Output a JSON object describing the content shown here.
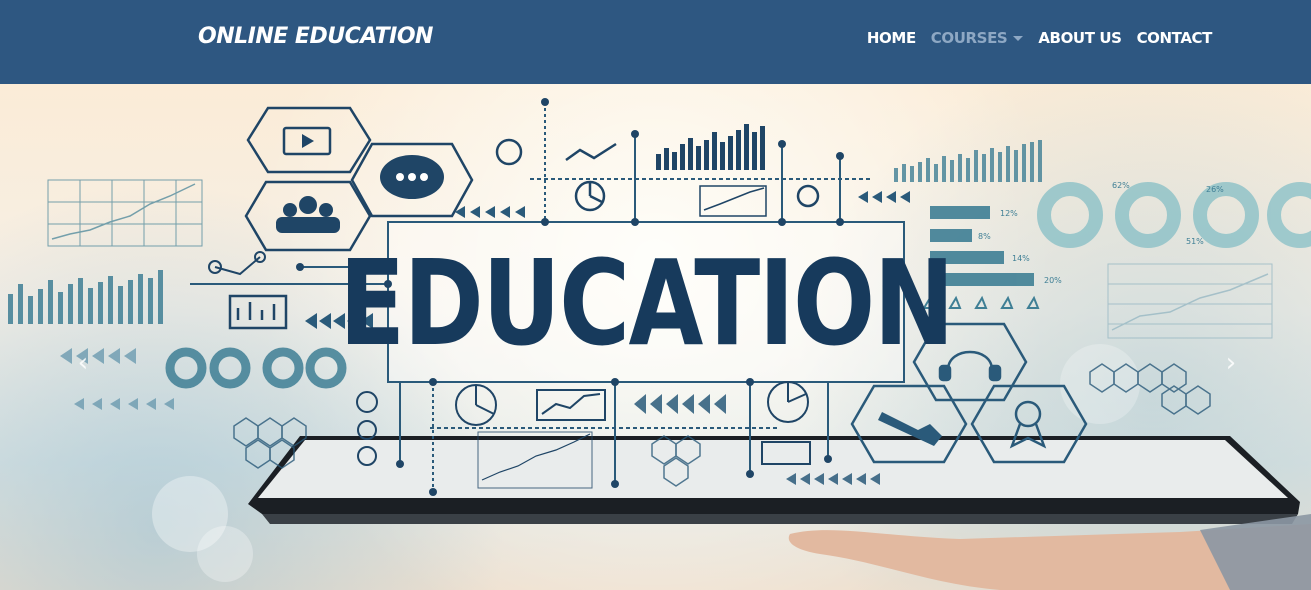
{
  "brand": {
    "title": "ONLINE EDUCATION"
  },
  "nav": {
    "items": [
      {
        "label": "HOME",
        "active": false
      },
      {
        "label": "COURSES",
        "active": true,
        "has_dropdown": true
      },
      {
        "label": "ABOUT US",
        "active": false
      },
      {
        "label": "CONTACT",
        "active": false
      }
    ]
  },
  "hero": {
    "headline": "EDUCATION",
    "prev_icon": "chevron-left-icon",
    "next_icon": "chevron-right-icon",
    "prev_glyph": "‹",
    "next_glyph": "›",
    "stat_labels": [
      "12%",
      "8%",
      "14%",
      "20%"
    ],
    "ring_labels": [
      "62%",
      "26%",
      "51%"
    ]
  },
  "colors": {
    "navbar": "#2e5781",
    "nav_text": "#ffffff",
    "nav_active": "#8ea8c4",
    "headline": "#173a5c",
    "icon_teal": "#3f7f95",
    "icon_navy": "#1f4566"
  }
}
